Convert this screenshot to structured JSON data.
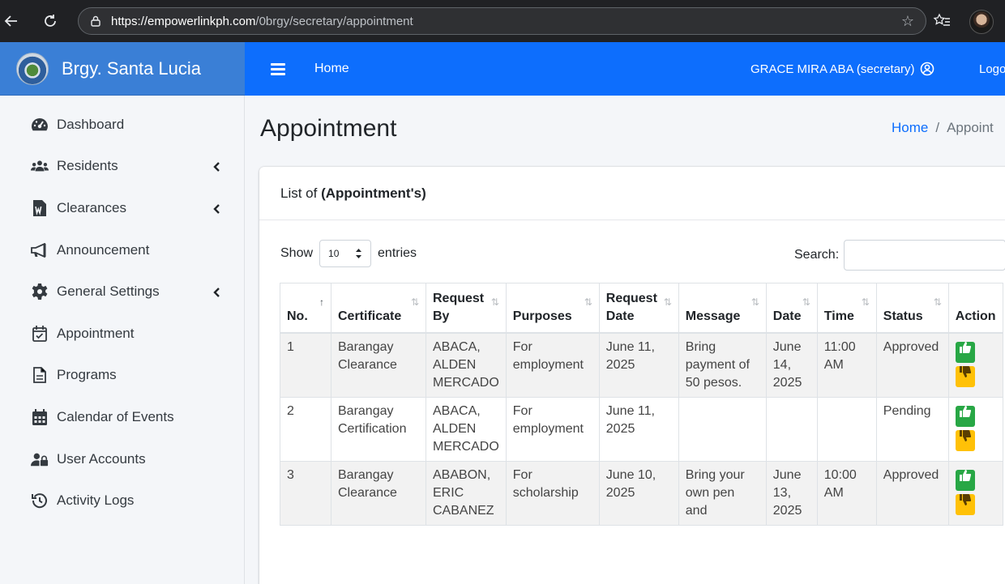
{
  "browser": {
    "url_domain": "https://empowerlinkph.com",
    "url_path": "/0brgy/secretary/appointment"
  },
  "brand": {
    "name": "Brgy. Santa Lucia"
  },
  "topnav": {
    "home": "Home",
    "user": "GRACE MIRA ABA (secretary)",
    "logout": "Logou"
  },
  "sidebar": {
    "items": [
      {
        "label": "Dashboard",
        "icon": "dashboard-gauge-icon",
        "has_submenu": false
      },
      {
        "label": "Residents",
        "icon": "users-icon",
        "has_submenu": true
      },
      {
        "label": "Clearances",
        "icon": "word-document-icon",
        "has_submenu": true
      },
      {
        "label": "Announcement",
        "icon": "megaphone-icon",
        "has_submenu": false
      },
      {
        "label": "General Settings",
        "icon": "gear-icon",
        "has_submenu": true
      },
      {
        "label": "Appointment",
        "icon": "calendar-check-icon",
        "has_submenu": false
      },
      {
        "label": "Programs",
        "icon": "document-icon",
        "has_submenu": false
      },
      {
        "label": "Calendar of Events",
        "icon": "calendar-icon",
        "has_submenu": false
      },
      {
        "label": "User Accounts",
        "icon": "user-lock-icon",
        "has_submenu": false
      },
      {
        "label": "Activity Logs",
        "icon": "history-icon",
        "has_submenu": false
      }
    ]
  },
  "page": {
    "title": "Appointment",
    "breadcrumb_home": "Home",
    "breadcrumb_sep": "/",
    "breadcrumb_current": "Appoint"
  },
  "card": {
    "title_prefix": "List of ",
    "title_bold": "(Appointment's)",
    "show_label": "Show",
    "entries_value": "10",
    "entries_label": "entries",
    "search_label": "Search:"
  },
  "table": {
    "headers": [
      "No.",
      "Certificate",
      "Request By",
      "Purposes",
      "Request Date",
      "Message",
      "Date",
      "Time",
      "Status",
      "Action"
    ],
    "rows": [
      [
        "1",
        "Barangay Clearance",
        "ABACA, ALDEN MERCADO",
        "For employment",
        "June 11, 2025",
        "Bring payment of 50 pesos.",
        "June 14, 2025",
        "11:00 AM",
        "Approved"
      ],
      [
        "2",
        "Barangay Certification",
        "ABACA, ALDEN MERCADO",
        "For employment",
        "June 11, 2025",
        "",
        "",
        "",
        "Pending"
      ],
      [
        "3",
        "Barangay Clearance",
        "ABABON, ERIC CABANEZ",
        "For scholarship",
        "June 10, 2025",
        "Bring your own pen and",
        "June 13, 2025",
        "10:00 AM",
        "Approved"
      ]
    ]
  },
  "colors": {
    "topnav": "#0d6efd",
    "brand_bar": "#3a7fd6",
    "approve": "#28a745",
    "reject": "#ffc107"
  }
}
